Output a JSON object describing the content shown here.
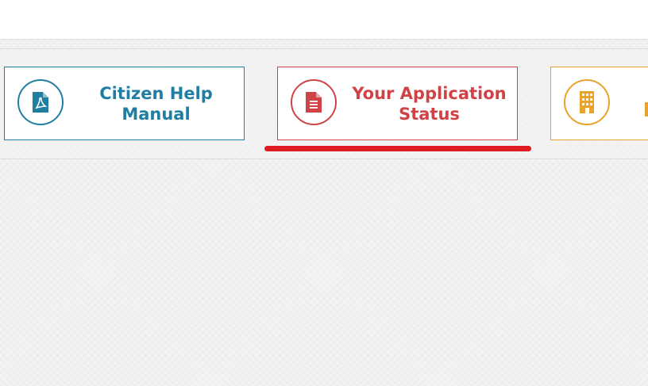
{
  "cards": [
    {
      "id": "help",
      "label": "Citizen Help\nManual",
      "icon": "pdf-file-icon",
      "color": "#1f7ea1"
    },
    {
      "id": "status",
      "label": "Your Application\nStatus",
      "icon": "document-icon",
      "color": "#cf4346"
    },
    {
      "id": "third",
      "label": "",
      "icon": "building-icon",
      "color": "#e9a22c"
    }
  ],
  "highlight_color": "#e01c22"
}
